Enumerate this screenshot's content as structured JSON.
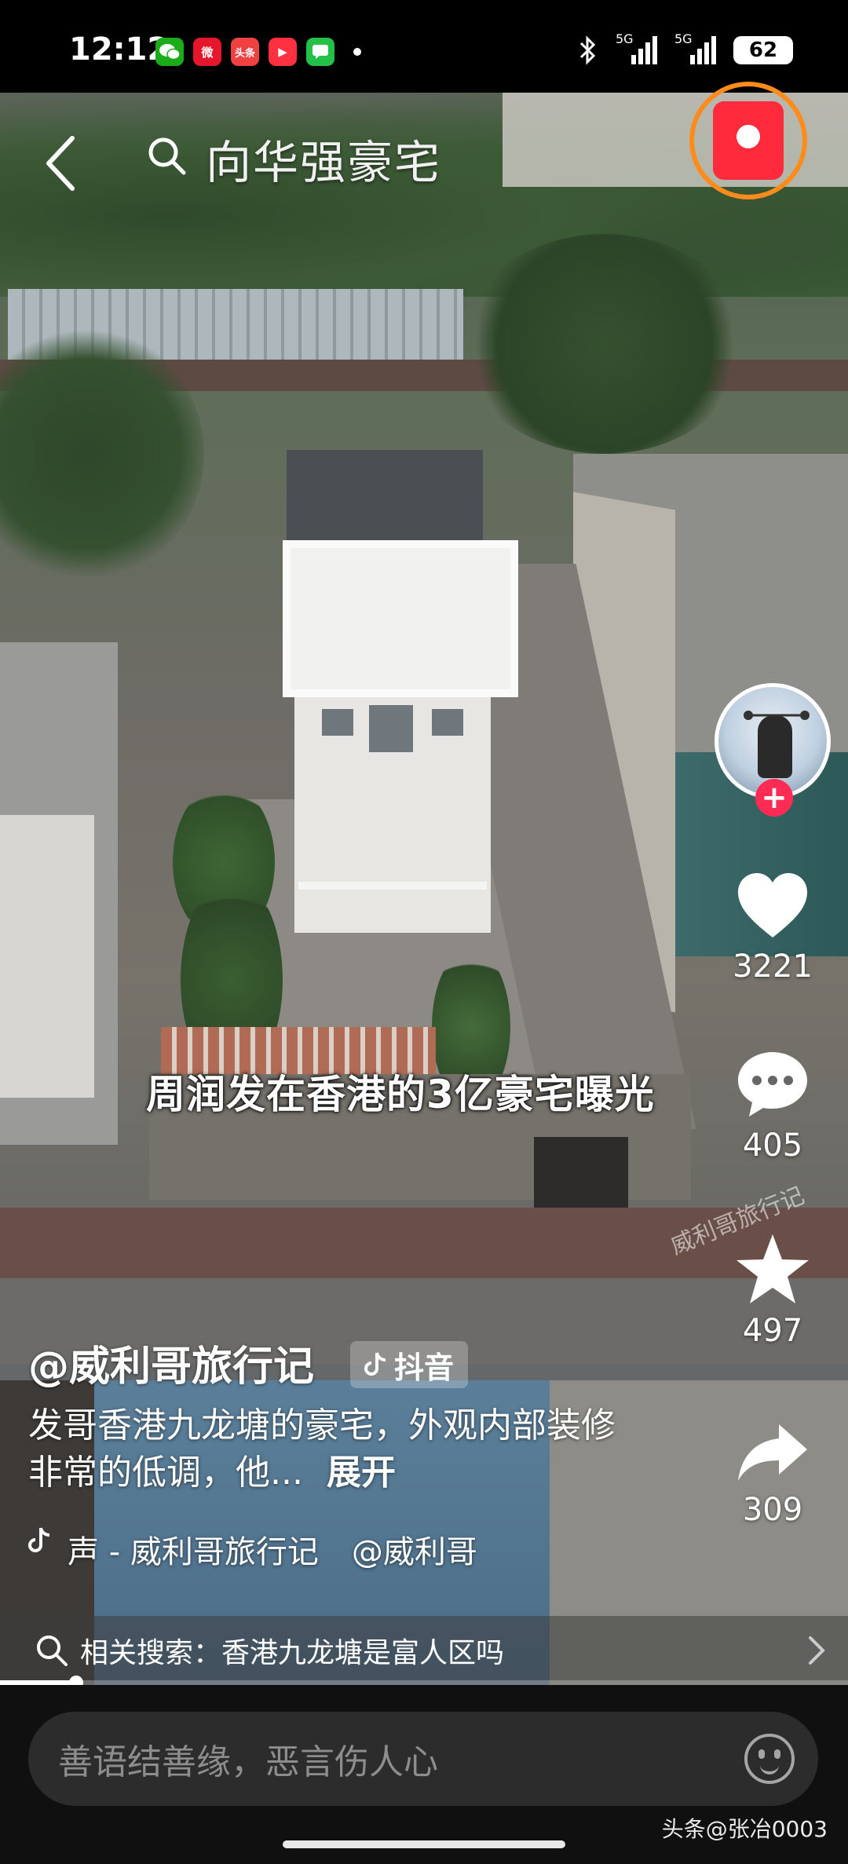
{
  "status_bar": {
    "time": "12:12",
    "battery": "62",
    "network_1": "5G",
    "network_2": "5G",
    "apps": [
      {
        "name": "wechat-icon",
        "label": "",
        "color": "#1aad19"
      },
      {
        "name": "weibo-icon",
        "label": "微",
        "color": "#e6162d"
      },
      {
        "name": "toutiao-icon",
        "label": "头条",
        "color": "#f04142"
      },
      {
        "name": "video-icon",
        "label": "▶",
        "color": "#ff3040"
      },
      {
        "name": "message-icon",
        "label": "",
        "color": "#24c149"
      }
    ]
  },
  "top_bar": {
    "search_query": "向华强豪宅"
  },
  "video": {
    "overlay_caption": "周润发在香港的3亿豪宅曝光",
    "watermark": "威利哥旅行记",
    "author": "@威利哥旅行记",
    "platform_tag": "抖音",
    "description": "发哥香港九龙塘的豪宅，外观内部装修非常的低调，他...",
    "expand_label": "展开",
    "music": "声 - 威利哥旅行记",
    "music_mention": "@威利哥",
    "progress_fraction": 0.09
  },
  "sidebar": {
    "likes": "3221",
    "comments": "405",
    "favorites": "497",
    "shares": "309",
    "follow_label": "+"
  },
  "related_search": {
    "label": "相关搜索：香港九龙塘是富人区吗"
  },
  "comment_bar": {
    "placeholder": "善语结善缘，恶言伤人心"
  },
  "attribution": "头条@张冶0003",
  "colors": {
    "accent": "#fe2c55",
    "redpacket_ring": "#ff8b1a",
    "redpacket": "#ff2a3c"
  }
}
